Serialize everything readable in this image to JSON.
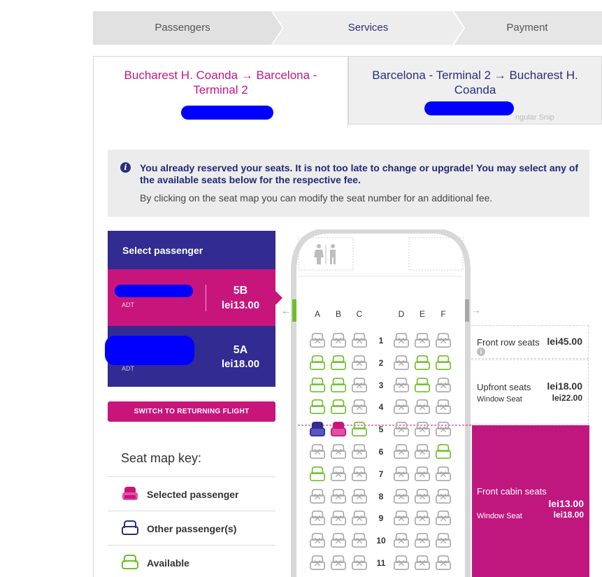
{
  "steps": [
    "Passengers",
    "Services",
    "Payment"
  ],
  "tabs": {
    "outbound": "Bucharest H. Coanda → Barcelona - Terminal 2",
    "return": "Barcelona - Terminal 2 → Bucharest H. Coanda",
    "return_overlay": "ngular Snip"
  },
  "info": {
    "bold": "You already reserved your seats. It is not too late to change or upgrade! You may select any of the available seats below for the respective fee.",
    "normal": "By clicking on the seat map you can modify the seat number for an additional fee."
  },
  "passenger_panel": {
    "title": "Select passenger",
    "passengers": [
      {
        "type": "ADT",
        "seat": "5B",
        "price": "lei13.00"
      },
      {
        "type": "ADT",
        "seat": "5A",
        "price": "lei18.00"
      }
    ],
    "switch_label": "SWITCH TO RETURNING FLIGHT"
  },
  "seat_key": {
    "title": "Seat map key:",
    "items": [
      "Selected passenger",
      "Other passenger(s)",
      "Available"
    ]
  },
  "seat_map": {
    "columns": [
      "A",
      "B",
      "C",
      "D",
      "E",
      "F"
    ],
    "rows": [
      {
        "num": "1",
        "seats": [
          "x",
          "x",
          "x",
          "x",
          "x",
          "x"
        ]
      },
      {
        "num": "2",
        "seats": [
          "a",
          "a",
          "x",
          "x",
          "a",
          "a"
        ]
      },
      {
        "num": "3",
        "seats": [
          "a",
          "a",
          "x",
          "x",
          "a",
          "x"
        ]
      },
      {
        "num": "4",
        "seats": [
          "a",
          "a",
          "x",
          "x",
          "x",
          "x"
        ]
      },
      {
        "num": "5",
        "seats": [
          "o",
          "s",
          "a",
          "x",
          "x",
          "x"
        ]
      },
      {
        "num": "6",
        "seats": [
          "x",
          "x",
          "x",
          "x",
          "x",
          "a"
        ]
      },
      {
        "num": "7",
        "seats": [
          "a",
          "x",
          "x",
          "x",
          "x",
          "x"
        ]
      },
      {
        "num": "8",
        "seats": [
          "x",
          "x",
          "x",
          "x",
          "x",
          "x"
        ]
      },
      {
        "num": "9",
        "seats": [
          "x",
          "x",
          "x",
          "x",
          "x",
          "x"
        ]
      },
      {
        "num": "10",
        "seats": [
          "x",
          "x",
          "x",
          "x",
          "x",
          "x"
        ]
      },
      {
        "num": "11",
        "seats": [
          "x",
          "x",
          "x",
          "x",
          "x",
          "x"
        ]
      }
    ]
  },
  "pricing": {
    "front_row": {
      "label": "Front row seats",
      "price": "lei45.00"
    },
    "upfront": {
      "label": "Upfront seats",
      "price": "lei18.00",
      "window_label": "Window Seat",
      "window_price": "lei22.00"
    },
    "front_cabin": {
      "label": "Front cabin seats",
      "price": "lei13.00",
      "window_label": "Window Seat",
      "window_price": "lei18.00"
    }
  },
  "colors": {
    "brand_pink": "#c8157c",
    "brand_purple": "#312b92",
    "available_green": "#6cbf2a",
    "taken_gray": "#a8a8a8"
  }
}
